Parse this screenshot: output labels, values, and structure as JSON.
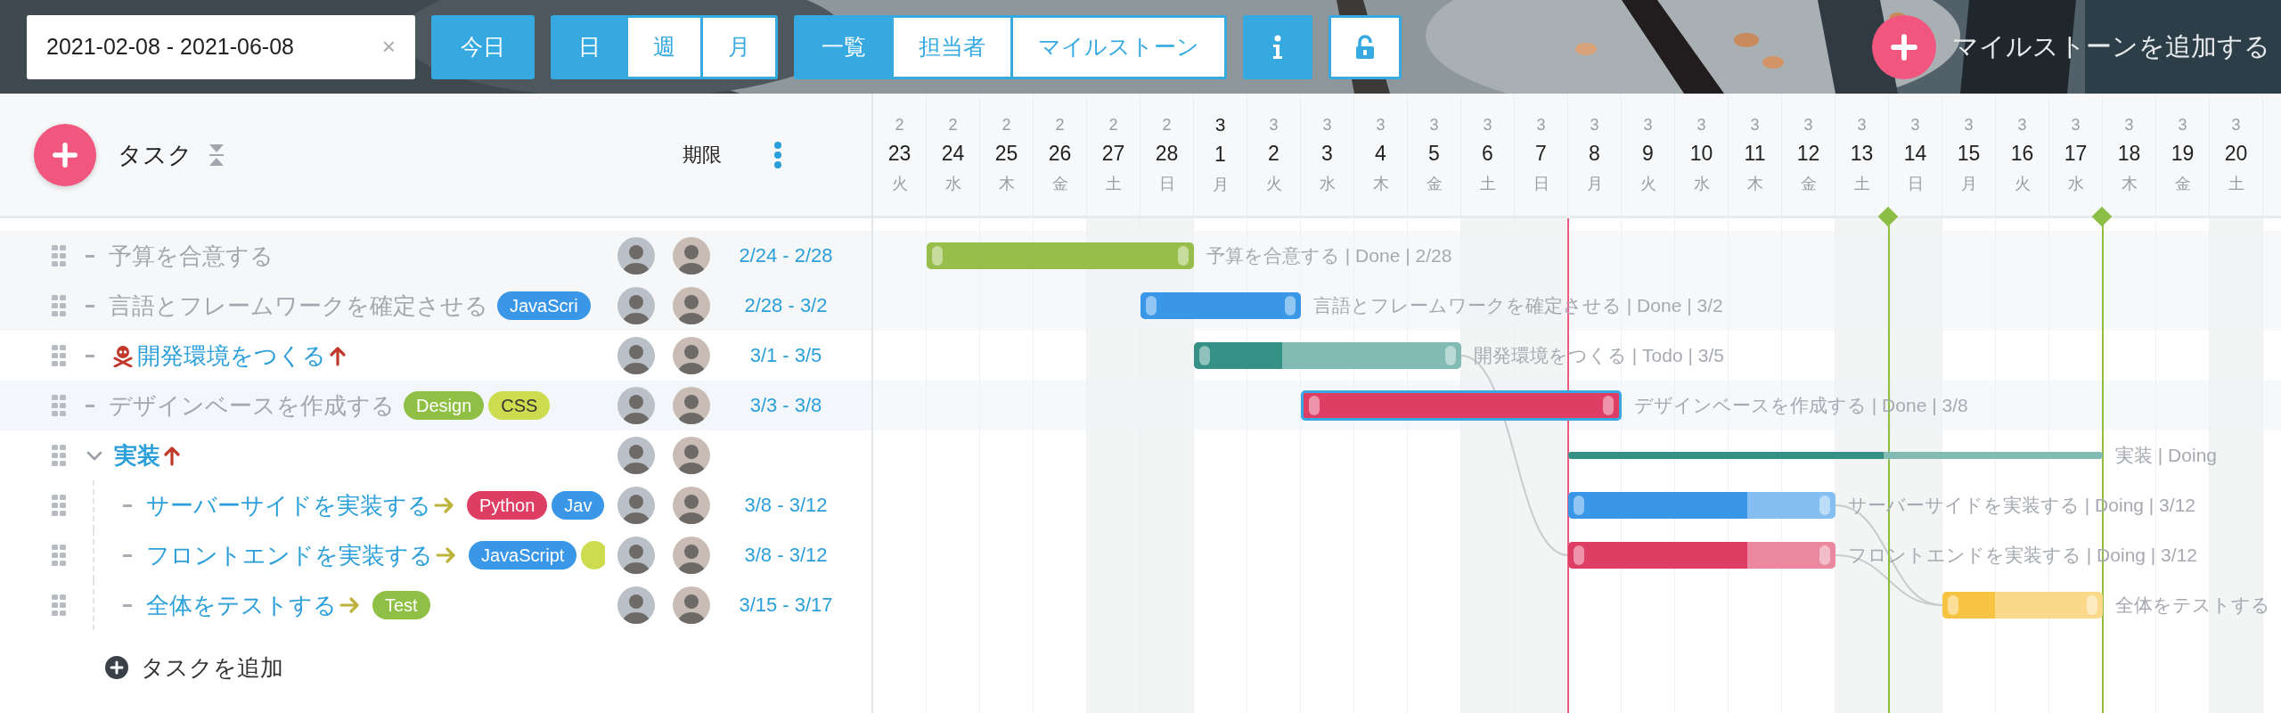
{
  "toolbar": {
    "date_range": {
      "value": "2021-02-08 - 2021-06-08",
      "clear": "×"
    },
    "today_button": "今日",
    "scale_tabs": [
      {
        "label": "日",
        "selected": true
      },
      {
        "label": "週",
        "selected": false
      },
      {
        "label": "月",
        "selected": false
      }
    ],
    "view_tabs": [
      {
        "label": "一覧",
        "selected": true
      },
      {
        "label": "担当者",
        "selected": false
      },
      {
        "label": "マイルストーン",
        "selected": false
      }
    ],
    "lock": {
      "locked": false
    },
    "add_milestone": "マイルストーンを追加する",
    "background": {
      "kind": "picture"
    }
  },
  "task_header": {
    "title": "タスク",
    "deadline": "期限"
  },
  "days": [
    {
      "month": "2",
      "day": "23",
      "weekday": "火",
      "weekend": false,
      "month_start": false,
      "today": false,
      "milestone": false
    },
    {
      "month": "2",
      "day": "24",
      "weekday": "水",
      "weekend": false,
      "month_start": false,
      "today": false,
      "milestone": false
    },
    {
      "month": "2",
      "day": "25",
      "weekday": "木",
      "weekend": false,
      "month_start": false,
      "today": false,
      "milestone": false
    },
    {
      "month": "2",
      "day": "26",
      "weekday": "金",
      "weekend": false,
      "month_start": false,
      "today": false,
      "milestone": false
    },
    {
      "month": "2",
      "day": "27",
      "weekday": "土",
      "weekend": true,
      "month_start": false,
      "today": false,
      "milestone": false
    },
    {
      "month": "2",
      "day": "28",
      "weekday": "日",
      "weekend": true,
      "month_start": false,
      "today": false,
      "milestone": false
    },
    {
      "month": "3",
      "day": "1",
      "weekday": "月",
      "weekend": false,
      "month_start": true,
      "today": false,
      "milestone": false
    },
    {
      "month": "3",
      "day": "2",
      "weekday": "火",
      "weekend": false,
      "month_start": false,
      "today": false,
      "milestone": false
    },
    {
      "month": "3",
      "day": "3",
      "weekday": "水",
      "weekend": false,
      "month_start": false,
      "today": false,
      "milestone": false
    },
    {
      "month": "3",
      "day": "4",
      "weekday": "木",
      "weekend": false,
      "month_start": false,
      "today": false,
      "milestone": false
    },
    {
      "month": "3",
      "day": "5",
      "weekday": "金",
      "weekend": false,
      "month_start": false,
      "today": false,
      "milestone": false
    },
    {
      "month": "3",
      "day": "6",
      "weekday": "土",
      "weekend": true,
      "month_start": false,
      "today": false,
      "milestone": false
    },
    {
      "month": "3",
      "day": "7",
      "weekday": "日",
      "weekend": true,
      "month_start": false,
      "today": false,
      "milestone": false
    },
    {
      "month": "3",
      "day": "8",
      "weekday": "月",
      "weekend": false,
      "month_start": false,
      "today": true,
      "milestone": false
    },
    {
      "month": "3",
      "day": "9",
      "weekday": "火",
      "weekend": false,
      "month_start": false,
      "today": false,
      "milestone": false
    },
    {
      "month": "3",
      "day": "10",
      "weekday": "水",
      "weekend": false,
      "month_start": false,
      "today": false,
      "milestone": false
    },
    {
      "month": "3",
      "day": "11",
      "weekday": "木",
      "weekend": false,
      "month_start": false,
      "today": false,
      "milestone": false
    },
    {
      "month": "3",
      "day": "12",
      "weekday": "金",
      "weekend": false,
      "month_start": false,
      "today": false,
      "milestone": false
    },
    {
      "month": "3",
      "day": "13",
      "weekday": "土",
      "weekend": true,
      "month_start": false,
      "today": false,
      "milestone": false
    },
    {
      "month": "3",
      "day": "14",
      "weekday": "日",
      "weekend": true,
      "month_start": false,
      "today": false,
      "milestone": true
    },
    {
      "month": "3",
      "day": "15",
      "weekday": "月",
      "weekend": false,
      "month_start": false,
      "today": false,
      "milestone": false
    },
    {
      "month": "3",
      "day": "16",
      "weekday": "火",
      "weekend": false,
      "month_start": false,
      "today": false,
      "milestone": false
    },
    {
      "month": "3",
      "day": "17",
      "weekday": "水",
      "weekend": false,
      "month_start": false,
      "today": false,
      "milestone": false
    },
    {
      "month": "3",
      "day": "18",
      "weekday": "木",
      "weekend": false,
      "month_start": false,
      "today": false,
      "milestone": true
    },
    {
      "month": "3",
      "day": "19",
      "weekday": "金",
      "weekend": false,
      "month_start": false,
      "today": false,
      "milestone": false
    },
    {
      "month": "3",
      "day": "20",
      "weekday": "土",
      "weekend": true,
      "month_start": false,
      "today": false,
      "milestone": false
    }
  ],
  "tasks": [
    {
      "kind": "task",
      "title": "予算を合意する",
      "done": true,
      "selected": false,
      "avatars": [
        {
          "kind": "picture"
        },
        {
          "kind": "picture"
        }
      ],
      "dates": "2/24 - 2/28",
      "bar": {
        "color": "#97be4b",
        "level": 1,
        "label": "予算を合意する | Done | 2/28"
      }
    },
    {
      "kind": "task",
      "title": "言語とフレームワークを確定させる",
      "done": true,
      "selected": false,
      "tags": [
        {
          "label": "JavaScri",
          "color": "#3a97e8"
        }
      ],
      "avatars": [
        {
          "kind": "picture"
        },
        {
          "kind": "picture"
        }
      ],
      "dates": "2/28 - 3/2",
      "bar": {
        "color": "#3a97e8",
        "level": 1,
        "label": "言語とフレームワークを確定させる | Done | 3/2"
      }
    },
    {
      "kind": "task",
      "title": "開発環境をつくる",
      "done": false,
      "selected": false,
      "icon_before": {
        "kind": "skull"
      },
      "icon_after": {
        "kind": "up"
      },
      "avatars": [
        {
          "kind": "picture"
        },
        {
          "kind": "picture"
        }
      ],
      "dates": "3/1 - 3/5",
      "bar": {
        "color": "#359185",
        "level": 0.33,
        "label": "開発環境をつくる | Todo | 3/5"
      }
    },
    {
      "kind": "task",
      "title": "デザインベースを作成する",
      "done": true,
      "selected": true,
      "tags": [
        {
          "label": "Design",
          "color": "#8fbf45"
        },
        {
          "label": "CSS",
          "color": "#cddc4f"
        }
      ],
      "avatars": [
        {
          "kind": "picture"
        },
        {
          "kind": "picture"
        }
      ],
      "dates": "3/3 - 3/8",
      "bar": {
        "color": "#de3d64",
        "level": 1,
        "label": "デザインベースを作成する | Done | 3/8"
      }
    },
    {
      "kind": "group",
      "title": "実装",
      "done": false,
      "selected": false,
      "expanded": true,
      "icon_after": {
        "kind": "up"
      },
      "avatars": [
        {
          "kind": "picture"
        },
        {
          "kind": "picture"
        }
      ],
      "bar": {
        "color": "#359185",
        "level": 0.59,
        "label": "実装 | Doing"
      },
      "children": [
        {
          "kind": "task",
          "title": "サーバーサイドを実装する",
          "done": false,
          "selected": false,
          "icon_after": {
            "kind": "right"
          },
          "tags": [
            {
              "label": "Python",
              "color": "#de3d64"
            },
            {
              "label": "Jav",
              "color": "#3a97e8"
            }
          ],
          "avatars": [
            {
              "kind": "picture"
            },
            {
              "kind": "picture"
            }
          ],
          "dates": "3/8 - 3/12",
          "bar": {
            "color": "#3a97e8",
            "level": 0.67,
            "label": "サーバーサイドを実装する | Doing | 3/12"
          }
        },
        {
          "kind": "task",
          "title": "フロントエンドを実装する",
          "done": false,
          "selected": false,
          "icon_after": {
            "kind": "right"
          },
          "tags": [
            {
              "label": "JavaScript",
              "color": "#3a97e8"
            },
            {
              "color": "#cddc4f"
            }
          ],
          "avatars": [
            {
              "kind": "picture"
            },
            {
              "kind": "picture"
            }
          ],
          "dates": "3/8 - 3/12",
          "bar": {
            "color": "#de3d64",
            "level": 0.67,
            "label": "フロントエンドを実装する | Doing | 3/12"
          }
        },
        {
          "kind": "task",
          "title": "全体をテストする",
          "done": false,
          "selected": false,
          "icon_after": {
            "kind": "right"
          },
          "tags": [
            {
              "label": "Test",
              "color": "#8fbf45"
            }
          ],
          "avatars": [
            {
              "kind": "picture"
            },
            {
              "kind": "picture"
            }
          ],
          "dates": "3/15 - 3/17",
          "bar": {
            "color": "#f7c343",
            "level": 0.33,
            "label": "全体をテストする"
          }
        }
      ]
    }
  ],
  "add_task": "タスクを追加"
}
